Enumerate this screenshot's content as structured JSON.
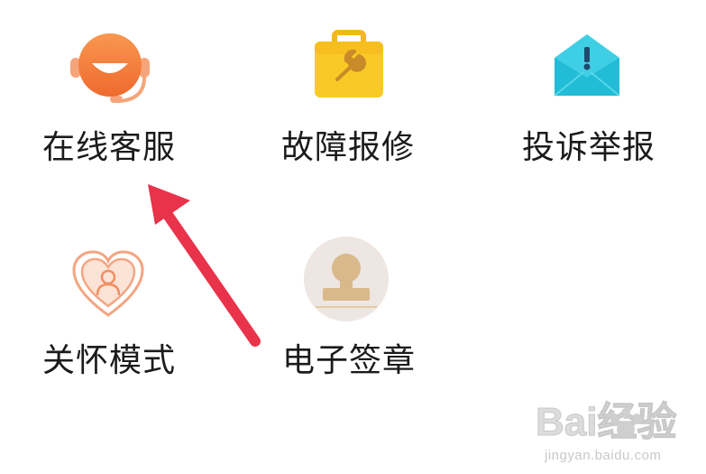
{
  "grid": {
    "items": [
      {
        "id": "online-service",
        "label": "在线客服",
        "icon": "headset-agent-icon",
        "color": "#F47B3A"
      },
      {
        "id": "fault-repair",
        "label": "故障报修",
        "icon": "toolbox-wrench-icon",
        "color": "#F7C51F"
      },
      {
        "id": "complaint-report",
        "label": "投诉举报",
        "icon": "envelope-alert-icon",
        "color": "#2EC6DE"
      },
      {
        "id": "care-mode",
        "label": "关怀模式",
        "icon": "heart-person-icon",
        "color": "#F3A582"
      },
      {
        "id": "e-seal",
        "label": "电子签章",
        "icon": "stamp-icon",
        "color": "#D9B98A"
      }
    ]
  },
  "annotation": {
    "arrow_color": "#E8334A",
    "points_to": "online-service"
  },
  "watermark": {
    "brand_text": "Bai经验",
    "url": "jingyan.baidu.com"
  }
}
